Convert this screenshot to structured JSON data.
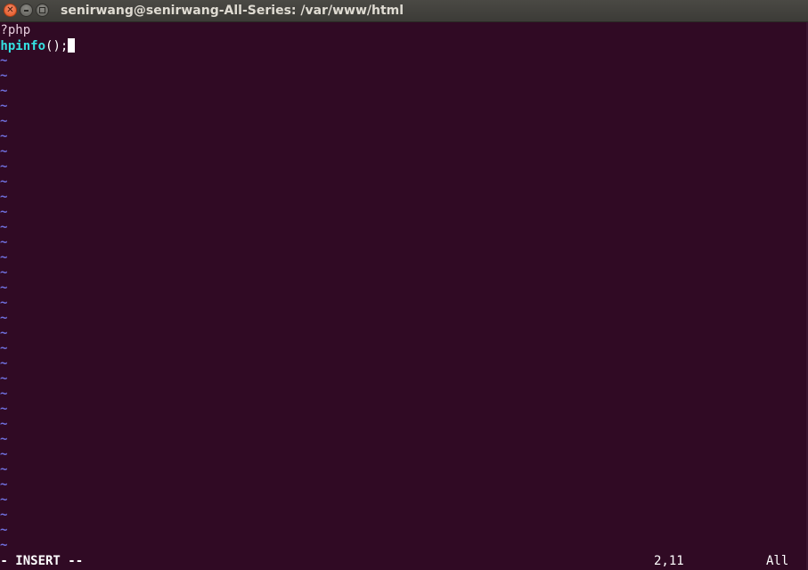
{
  "window": {
    "title": "senirwang@senirwang-All-Series: /var/www/html",
    "close_glyph": "✕"
  },
  "editor": {
    "lines": [
      {
        "open_tag": "<?php"
      },
      {
        "func": "phpinfo",
        "punct": "();"
      }
    ],
    "empty_line_marker": "~",
    "colors": {
      "background": "#300a24",
      "function": "#34e2e2",
      "tilde": "#6f6fdc"
    }
  },
  "statusbar": {
    "mode": "-- INSERT --",
    "position": "2,11",
    "scroll": "All"
  }
}
